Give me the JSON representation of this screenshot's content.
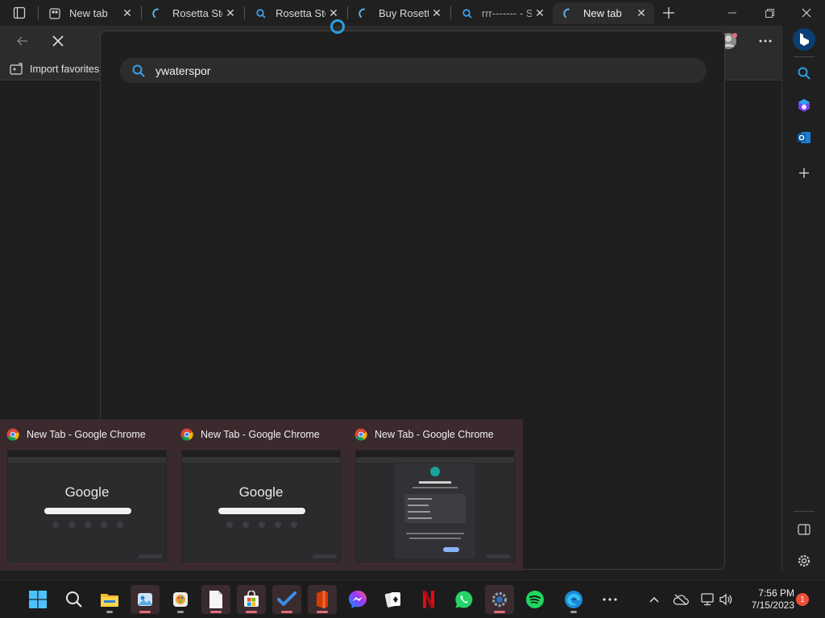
{
  "browser": {
    "tabs": [
      {
        "title": "New tab",
        "favicon": "newtab-icon"
      },
      {
        "title": "Rosetta Stone",
        "favicon": "loading-icon"
      },
      {
        "title": "Rosetta Stone",
        "favicon": "search-icon"
      },
      {
        "title": "Buy Rosetta",
        "favicon": "loading-icon"
      },
      {
        "title": "rrr------- - S",
        "favicon": "search-icon"
      },
      {
        "title": "New tab",
        "favicon": "loading-icon",
        "active": true
      }
    ],
    "favorites_bar": {
      "import_label": "Import favorites"
    },
    "search": {
      "value": "ywaterspor"
    },
    "accent": "#2a9fe0"
  },
  "thumbnails": [
    {
      "title": "New Tab - Google Chrome",
      "preview": "google",
      "logo": "Google"
    },
    {
      "title": "New Tab - Google Chrome",
      "preview": "google",
      "logo": "Google"
    },
    {
      "title": "New Tab - Google Chrome",
      "preview": "dialog"
    }
  ],
  "taskbar": {
    "apps": [
      "start",
      "search",
      "file-explorer",
      "app-photos",
      "app-paint",
      "app-notepad",
      "app-store",
      "app-todo",
      "app-office",
      "app-messenger",
      "app-solitaire",
      "app-netflix",
      "app-whatsapp",
      "app-chrome",
      "app-spotify",
      "app-edge",
      "more-apps"
    ],
    "clock": {
      "time": "7:56 PM",
      "date": "7/15/2023"
    },
    "notification_count": "1"
  }
}
